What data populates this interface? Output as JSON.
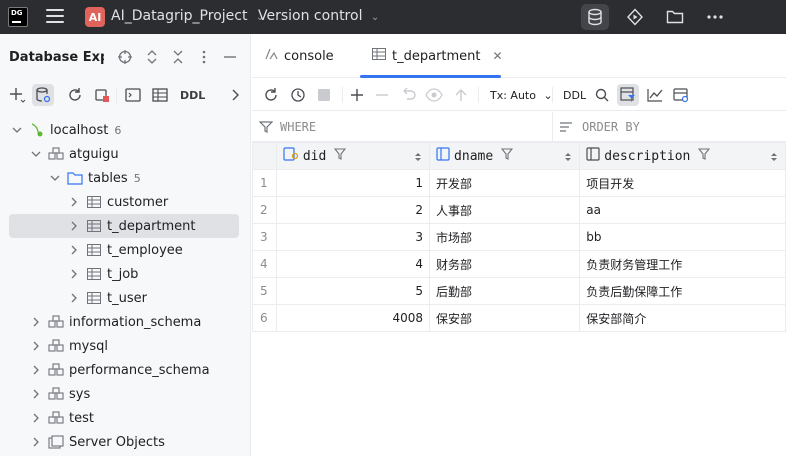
{
  "titlebar": {
    "logo_text": "DG",
    "project_badge": "AI",
    "project_name": "AI_Datagrip_Project",
    "version_control": "Version control",
    "icons": [
      "database-icon",
      "run-icon",
      "folder-icon",
      "more-icon"
    ]
  },
  "sidebar": {
    "title": "Database Explorer",
    "ddl_label": "DDL",
    "tree": [
      {
        "label": "localhost",
        "count": "6",
        "kind": "host"
      },
      {
        "label": "atguigu",
        "count": "",
        "kind": "schema"
      },
      {
        "label": "tables",
        "count": "5",
        "kind": "folder"
      },
      {
        "label": "customer",
        "count": "",
        "kind": "table"
      },
      {
        "label": "t_department",
        "count": "",
        "kind": "table"
      },
      {
        "label": "t_employee",
        "count": "",
        "kind": "table"
      },
      {
        "label": "t_job",
        "count": "",
        "kind": "table"
      },
      {
        "label": "t_user",
        "count": "",
        "kind": "table"
      },
      {
        "label": "information_schema",
        "count": "",
        "kind": "schema"
      },
      {
        "label": "mysql",
        "count": "",
        "kind": "schema"
      },
      {
        "label": "performance_schema",
        "count": "",
        "kind": "schema"
      },
      {
        "label": "sys",
        "count": "",
        "kind": "schema"
      },
      {
        "label": "test",
        "count": "",
        "kind": "schema"
      },
      {
        "label": "Server Objects",
        "count": "",
        "kind": "server"
      }
    ]
  },
  "tabs": [
    {
      "label": "console",
      "active": false
    },
    {
      "label": "t_department",
      "active": true
    }
  ],
  "toolbar": {
    "tx_label": "Tx: Auto",
    "ddl_label": "DDL"
  },
  "filter": {
    "where_placeholder": "WHERE",
    "order_placeholder": "ORDER BY"
  },
  "grid": {
    "columns": [
      "did",
      "dname",
      "description"
    ],
    "rows": [
      {
        "n": "1",
        "did": "1",
        "dname": "开发部",
        "description": "项目开发"
      },
      {
        "n": "2",
        "did": "2",
        "dname": "人事部",
        "description": "aa"
      },
      {
        "n": "3",
        "did": "3",
        "dname": "市场部",
        "description": "bb"
      },
      {
        "n": "4",
        "did": "4",
        "dname": "财务部",
        "description": "负责财务管理工作"
      },
      {
        "n": "5",
        "did": "5",
        "dname": "后勤部",
        "description": "负责后勤保障工作"
      },
      {
        "n": "6",
        "did": "4008",
        "dname": "保安部",
        "description": "保安部简介"
      }
    ]
  },
  "colors": {
    "titlebar_bg": "#2b2d30",
    "accent": "#3574f0",
    "selection": "#dfe1e5",
    "project_badge": "#e0645c"
  }
}
